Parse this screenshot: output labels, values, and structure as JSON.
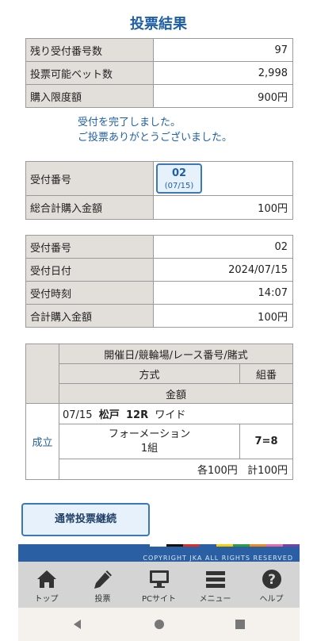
{
  "page_title": "投票結果",
  "summary": {
    "rows": [
      {
        "label": "残り受付番号数",
        "value": "97"
      },
      {
        "label": "投票可能ベット数",
        "value": "2,998"
      },
      {
        "label": "購入限度額",
        "value": "900円"
      }
    ]
  },
  "message": {
    "line1": "受付を完了しました。",
    "line2": "ご投票ありがとうございました。"
  },
  "receipt": {
    "label": "受付番号",
    "number": "02",
    "date": "(07/15)",
    "total_label": "総合計購入金額",
    "total_value": "100円"
  },
  "detail": {
    "rows": [
      {
        "label": "受付番号",
        "value": "02"
      },
      {
        "label": "受付日付",
        "value": "2024/07/15"
      },
      {
        "label": "受付時刻",
        "value": "14:07"
      },
      {
        "label": "合計購入金額",
        "value": "100円"
      }
    ]
  },
  "bets": {
    "header_race": "開催日/競輪場/レース番号/賭式",
    "header_method": "方式",
    "header_combo": "組番",
    "header_amount": "金額",
    "status": "成立",
    "date": "07/15",
    "venue": "松戸",
    "race": "12R",
    "bet_type": "ワイド",
    "method": "フォーメーション",
    "units": "1組",
    "combo": "7=8",
    "amount_each": "各100円",
    "amount_total": "計100円"
  },
  "continue_button": "通常投票継続",
  "footer": {
    "copyright": "COPYRIGHT JKA ALL RIGHTS RESERVED",
    "strip_colors": [
      "#ffffff",
      "#111111",
      "#e02b2b",
      "#2a5fa3",
      "#f5d000",
      "#2e9e44",
      "#f08a1c",
      "#e66aa8",
      "#7a3fa8"
    ]
  },
  "nav": {
    "items": [
      {
        "label": "トップ",
        "icon": "home-icon"
      },
      {
        "label": "投票",
        "icon": "pencil-icon"
      },
      {
        "label": "PCサイト",
        "icon": "monitor-icon"
      },
      {
        "label": "メニュー",
        "icon": "menu-icon"
      },
      {
        "label": "ヘルプ",
        "icon": "help-icon"
      }
    ]
  },
  "colors": {
    "accent": "#1f5fa6",
    "label_bg": "#e2dfda",
    "button_bg": "#e6f1fb",
    "footer_band": "#2a5fa3",
    "nav_bg": "#d4d4d4"
  }
}
